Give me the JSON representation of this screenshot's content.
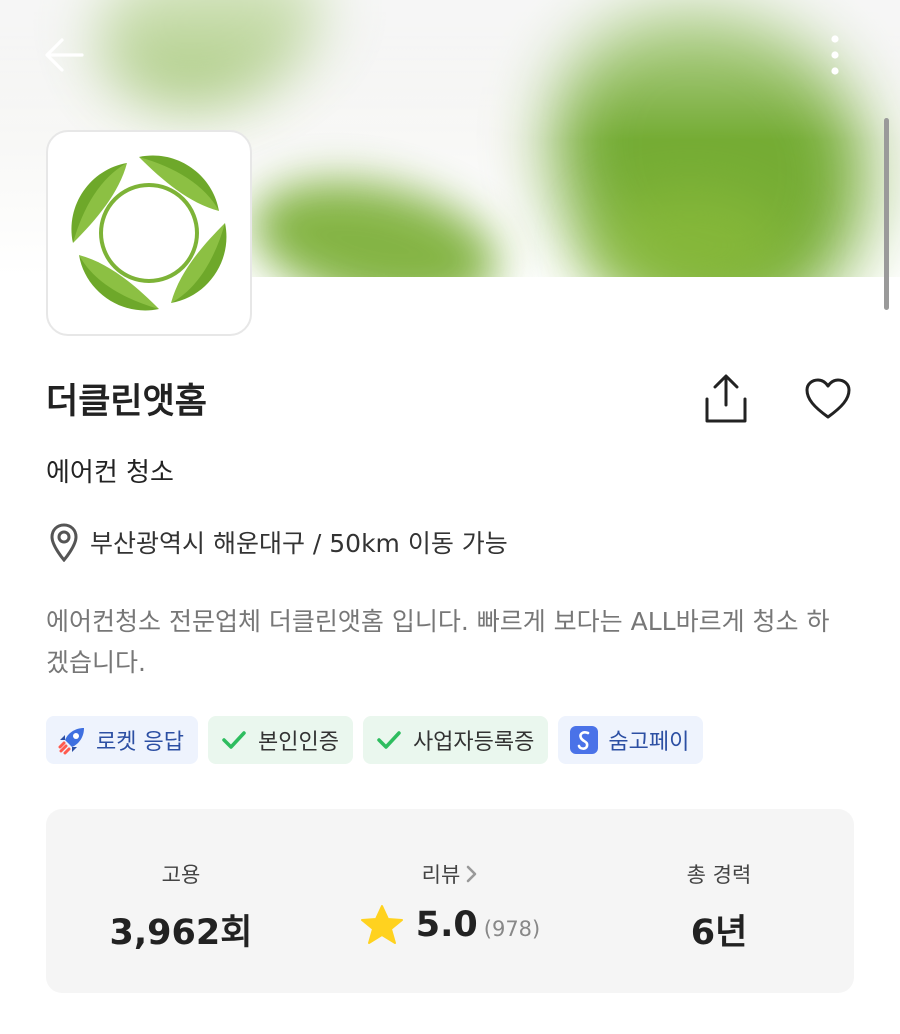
{
  "header": {
    "back_icon": "arrow-left-icon",
    "more_icon": "more-vertical-icon"
  },
  "profile": {
    "name": "더클린앳홈",
    "service": "에어컨 청소",
    "location": "부산광역시 해운대구 / 50km 이동 가능",
    "description": "에어컨청소 전문업체 더클린앳홈 입니다.  빠르게 보다는 ALL바르게 청소 하겠습니다."
  },
  "badges": [
    {
      "label": "로켓 응답",
      "icon": "rocket-icon"
    },
    {
      "label": "본인인증",
      "icon": "check-icon"
    },
    {
      "label": "사업자등록증",
      "icon": "check-icon"
    },
    {
      "label": "숨고페이",
      "icon": "soomgo-pay-icon"
    }
  ],
  "stats": {
    "hires": {
      "label": "고용",
      "value": "3,962회"
    },
    "reviews": {
      "label": "리뷰",
      "rating": "5.0",
      "count": "(978)"
    },
    "career": {
      "label": "총 경력",
      "value": "6년"
    }
  },
  "colors": {
    "brand_green": "#6ea82a",
    "badge_blue_bg": "#eef3fd",
    "badge_blue_text": "#2c4fa3",
    "badge_green_bg": "#eaf7ee",
    "check_green": "#2ebd5f",
    "star_yellow": "#ffd21f",
    "stats_bg": "#f5f5f5"
  }
}
